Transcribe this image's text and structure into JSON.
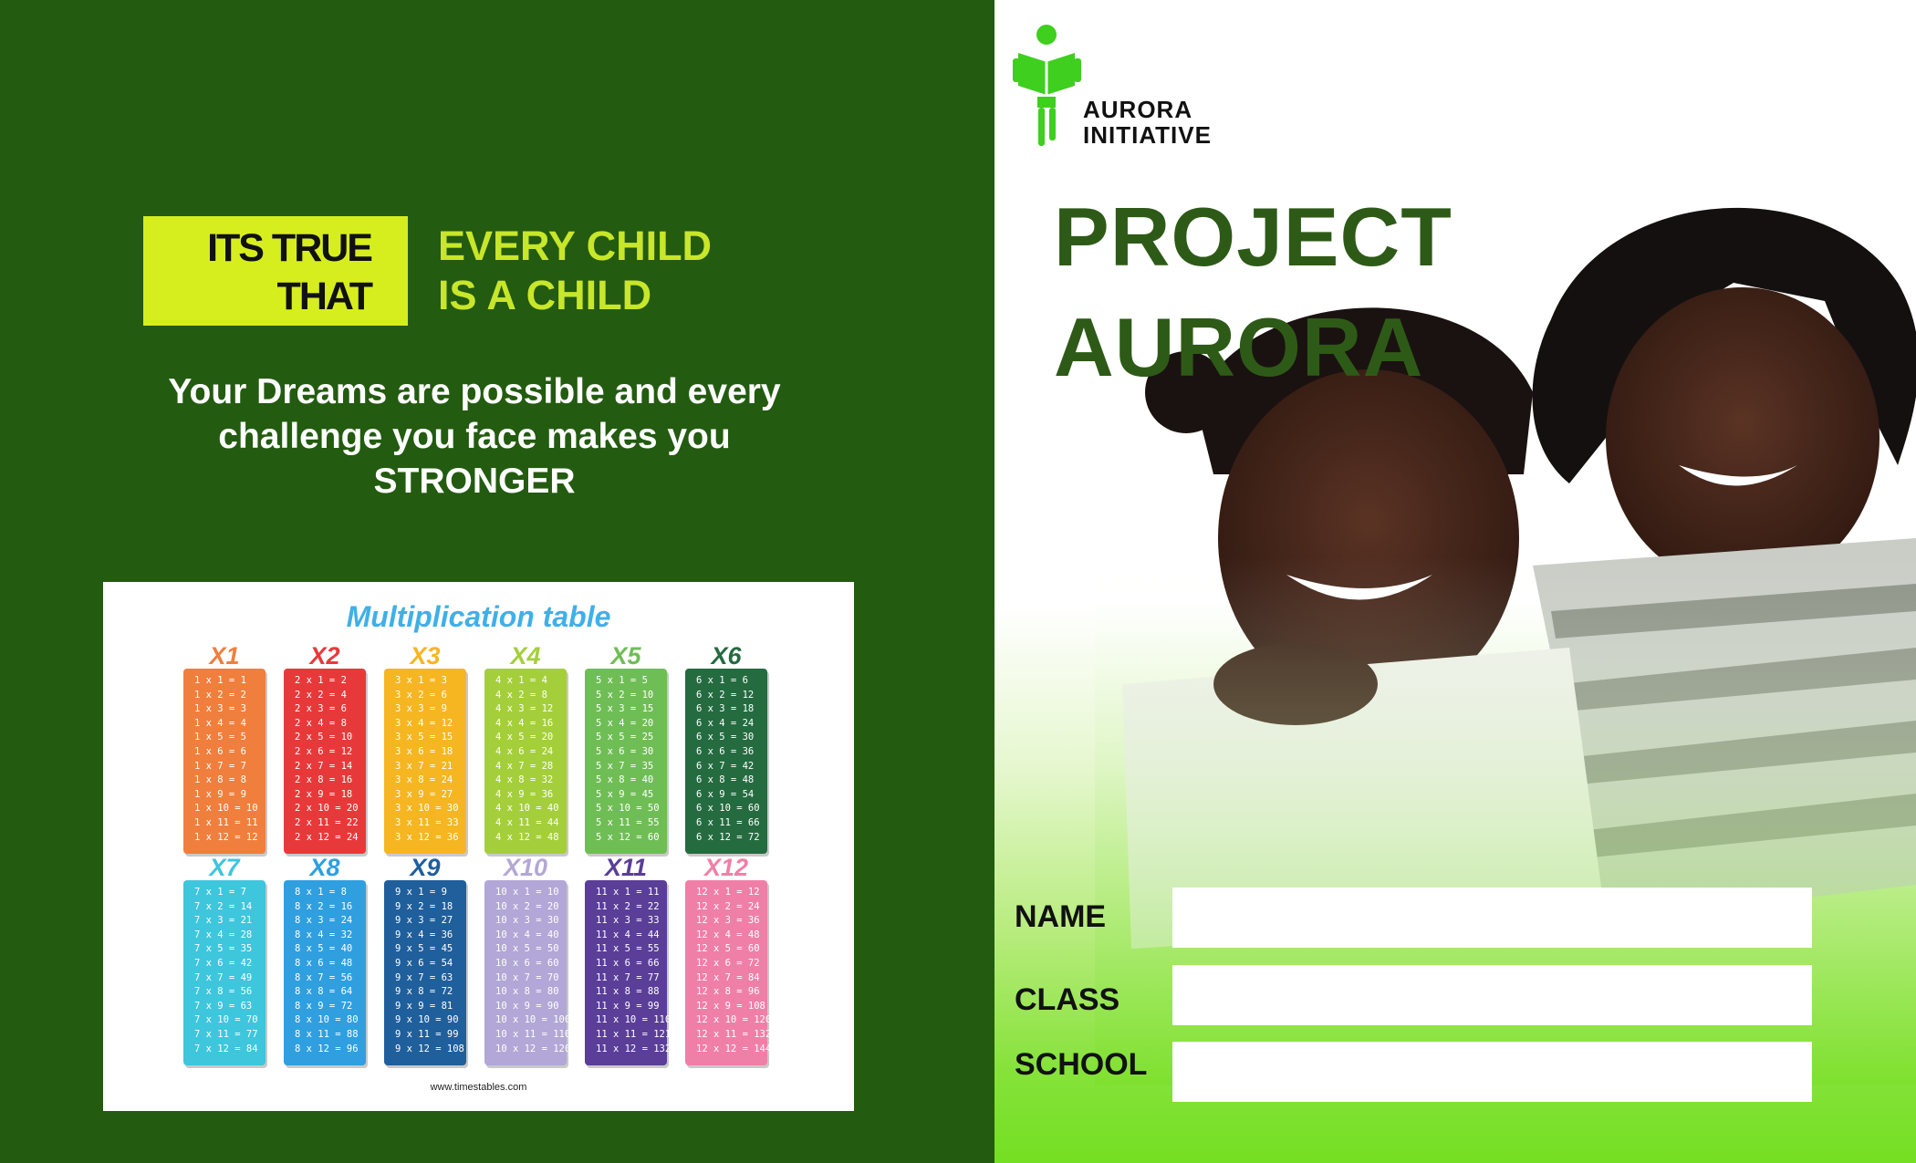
{
  "left": {
    "badge_line1": "ITS TRUE",
    "badge_line2": "THAT",
    "tag_line1": "EVERY CHILD",
    "tag_line2": "IS A CHILD",
    "quote_line1": "Your Dreams are possible and every",
    "quote_line2": "challenge you face makes you",
    "quote_line3": "STRONGER"
  },
  "poster": {
    "title": "Multiplication table",
    "url": "www.timestables.com",
    "columns": [
      {
        "label": "X1",
        "color": "#f07f3e",
        "head": "#f07f3e"
      },
      {
        "label": "X2",
        "color": "#e8393a",
        "head": "#e8393a"
      },
      {
        "label": "X3",
        "color": "#f6b622",
        "head": "#f6b622"
      },
      {
        "label": "X4",
        "color": "#a4cf3b",
        "head": "#a4cf3b"
      },
      {
        "label": "X5",
        "color": "#6fbe55",
        "head": "#6fbe55"
      },
      {
        "label": "X6",
        "color": "#256b40",
        "head": "#256b40"
      },
      {
        "label": "X7",
        "color": "#3ec6dd",
        "head": "#3ec6dd"
      },
      {
        "label": "X8",
        "color": "#2f9fe0",
        "head": "#2f9fe0"
      },
      {
        "label": "X9",
        "color": "#1f5f9c",
        "head": "#1f5f9c"
      },
      {
        "label": "X10",
        "color": "#b2a7d6",
        "head": "#b2a7d6"
      },
      {
        "label": "X11",
        "color": "#5a3e98",
        "head": "#5a3e98"
      },
      {
        "label": "X12",
        "color": "#f07fa7",
        "head": "#f07fa7"
      }
    ]
  },
  "right": {
    "logo_line1": "AURORA",
    "logo_line2": "INITIATIVE",
    "title_line1": "PROJECT",
    "title_line2": "AURORA",
    "form": {
      "name_label": "NAME",
      "class_label": "CLASS",
      "school_label": "SCHOOL",
      "name_value": "",
      "class_value": "",
      "school_value": ""
    }
  }
}
